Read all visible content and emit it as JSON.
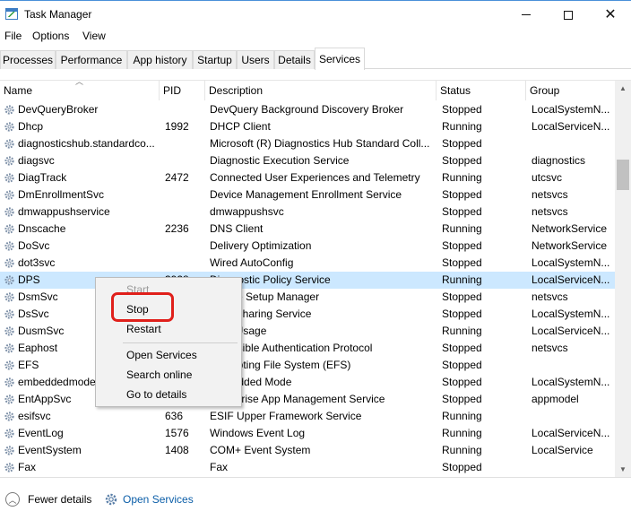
{
  "window": {
    "title": "Task Manager"
  },
  "menu": [
    "File",
    "Options",
    "View"
  ],
  "tabs": [
    "Processes",
    "Performance",
    "App history",
    "Startup",
    "Users",
    "Details",
    "Services"
  ],
  "active_tab": "Services",
  "columns": [
    "Name",
    "PID",
    "Description",
    "Status",
    "Group"
  ],
  "selected_row": "DPS",
  "rows": [
    {
      "name": "DevQueryBroker",
      "pid": "",
      "desc": "DevQuery Background Discovery Broker",
      "status": "Stopped",
      "group": "LocalSystemN..."
    },
    {
      "name": "Dhcp",
      "pid": "1992",
      "desc": "DHCP Client",
      "status": "Running",
      "group": "LocalServiceN..."
    },
    {
      "name": "diagnosticshub.standardco...",
      "pid": "",
      "desc": "Microsoft (R) Diagnostics Hub Standard Coll...",
      "status": "Stopped",
      "group": ""
    },
    {
      "name": "diagsvc",
      "pid": "",
      "desc": "Diagnostic Execution Service",
      "status": "Stopped",
      "group": "diagnostics"
    },
    {
      "name": "DiagTrack",
      "pid": "2472",
      "desc": "Connected User Experiences and Telemetry",
      "status": "Running",
      "group": "utcsvc"
    },
    {
      "name": "DmEnrollmentSvc",
      "pid": "",
      "desc": "Device Management Enrollment Service",
      "status": "Stopped",
      "group": "netsvcs"
    },
    {
      "name": "dmwappushservice",
      "pid": "",
      "desc": "dmwappushsvc",
      "status": "Stopped",
      "group": "netsvcs"
    },
    {
      "name": "Dnscache",
      "pid": "2236",
      "desc": "DNS Client",
      "status": "Running",
      "group": "NetworkService"
    },
    {
      "name": "DoSvc",
      "pid": "",
      "desc": "Delivery Optimization",
      "status": "Stopped",
      "group": "NetworkService"
    },
    {
      "name": "dot3svc",
      "pid": "",
      "desc": "Wired AutoConfig",
      "status": "Stopped",
      "group": "LocalSystemN..."
    },
    {
      "name": "DPS",
      "pid": "3928",
      "desc": "Diagnostic Policy Service",
      "status": "Running",
      "group": "LocalServiceN..."
    },
    {
      "name": "DsmSvc",
      "pid": "",
      "desc": "Device Setup Manager",
      "status": "Stopped",
      "group": "netsvcs"
    },
    {
      "name": "DsSvc",
      "pid": "",
      "desc": "Data Sharing Service",
      "status": "Stopped",
      "group": "LocalSystemN..."
    },
    {
      "name": "DusmSvc",
      "pid": "",
      "desc": "Data Usage",
      "status": "Running",
      "group": "LocalServiceN..."
    },
    {
      "name": "Eaphost",
      "pid": "",
      "desc": "Extensible Authentication Protocol",
      "status": "Stopped",
      "group": "netsvcs"
    },
    {
      "name": "EFS",
      "pid": "",
      "desc": "Encrypting File System (EFS)",
      "status": "Stopped",
      "group": ""
    },
    {
      "name": "embeddedmode",
      "pid": "",
      "desc": "Embedded Mode",
      "status": "Stopped",
      "group": "LocalSystemN..."
    },
    {
      "name": "EntAppSvc",
      "pid": "",
      "desc": "Enterprise App Management Service",
      "status": "Stopped",
      "group": "appmodel"
    },
    {
      "name": "esifsvc",
      "pid": "636",
      "desc": "ESIF Upper Framework Service",
      "status": "Running",
      "group": ""
    },
    {
      "name": "EventLog",
      "pid": "1576",
      "desc": "Windows Event Log",
      "status": "Running",
      "group": "LocalServiceN..."
    },
    {
      "name": "EventSystem",
      "pid": "1408",
      "desc": "COM+ Event System",
      "status": "Running",
      "group": "LocalService"
    },
    {
      "name": "Fax",
      "pid": "",
      "desc": "Fax",
      "status": "Stopped",
      "group": ""
    }
  ],
  "context_menu": {
    "items": [
      "Start",
      "Stop",
      "Restart",
      "Open Services",
      "Search online",
      "Go to details"
    ],
    "disabled": [
      "Start"
    ],
    "highlighted": "Stop",
    "highlight_color": "#e0201b"
  },
  "footer": {
    "fewer_details": "Fewer details",
    "open_services": "Open Services"
  },
  "colors": {
    "selection": "#cce8ff",
    "link": "#0b5ea8"
  }
}
